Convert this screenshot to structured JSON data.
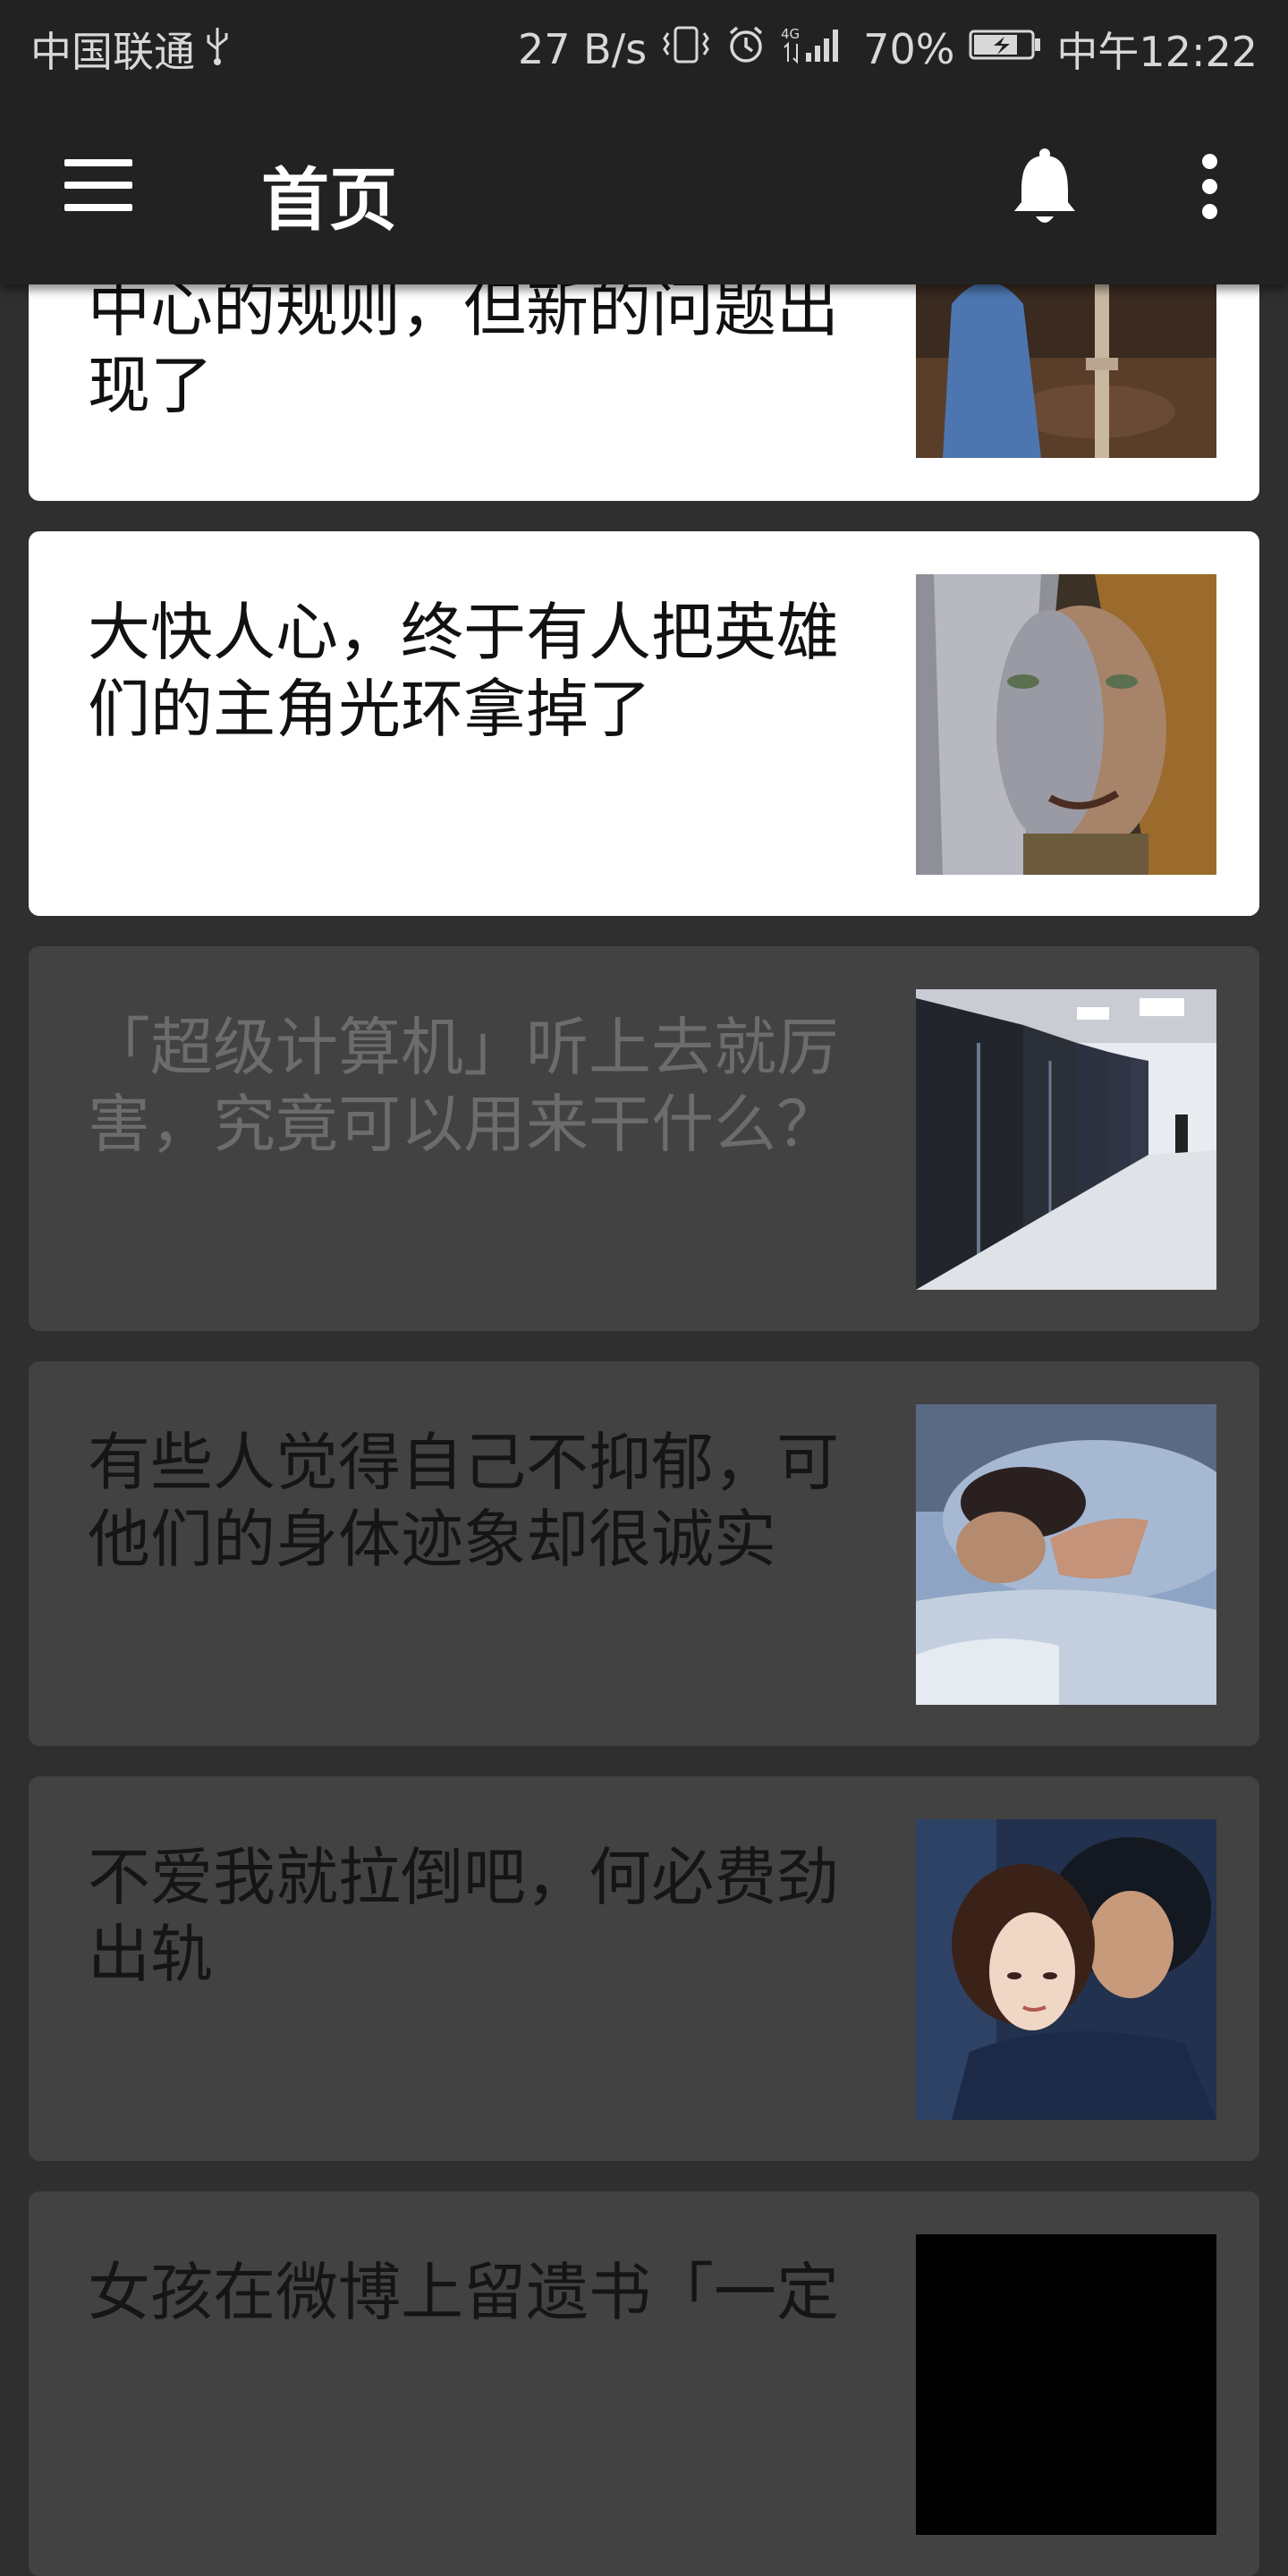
{
  "status_bar": {
    "carrier": "中国联通",
    "net_speed": "27 B/s",
    "network": "4G",
    "battery": "70%",
    "time": "中午12:22"
  },
  "app_bar": {
    "title": "首页"
  },
  "feed": {
    "items": [
      {
        "title": "中心的规则，但新的问题出现了",
        "style": "light",
        "read": false
      },
      {
        "title": "大快人心，终于有人把英雄们的主角光环拿掉了",
        "style": "light",
        "read": false
      },
      {
        "title": "「超级计算机」听上去就厉害，究竟可以用来干什么？",
        "style": "dark",
        "read": true
      },
      {
        "title": "有些人觉得自己不抑郁，可他们的身体迹象却很诚实",
        "style": "dark",
        "read": false
      },
      {
        "title": "不爱我就拉倒吧，何必费劲出轨",
        "style": "dark",
        "read": false
      },
      {
        "title": "女孩在微博上留遗书「一定",
        "style": "dark",
        "read": false
      }
    ]
  },
  "colors": {
    "app_bar": "#222222",
    "background": "#2f2f2f",
    "card_light": "#ffffff",
    "card_dark": "#424242"
  }
}
